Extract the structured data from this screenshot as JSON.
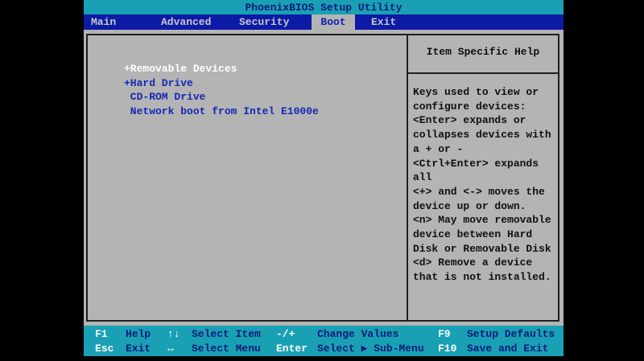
{
  "title": "PhoenixBIOS Setup Utility",
  "tabs": [
    "Main",
    "Advanced",
    "Security",
    "Boot",
    "Exit"
  ],
  "active_tab": "Boot",
  "boot_items": [
    "+Removable Devices",
    "+Hard Drive",
    " CD-ROM Drive",
    " Network boot from Intel E1000e"
  ],
  "help": {
    "title": "Item Specific Help",
    "lines": [
      "Keys used to view or",
      "configure devices:",
      "<Enter> expands or",
      "collapses devices with",
      "a + or -",
      "<Ctrl+Enter> expands",
      "all",
      "<+> and <-> moves the",
      "device up or down.",
      "<n> May move removable",
      "device between Hard",
      "Disk or Removable Disk",
      "<d> Remove a device",
      "that is not installed."
    ]
  },
  "footer": {
    "row1": [
      {
        "key": "F1",
        "label": "Help"
      },
      {
        "key": "↑↓",
        "label": "Select Item"
      },
      {
        "key": "-/+",
        "label": "Change Values"
      },
      {
        "key": "F9",
        "label": "Setup Defaults"
      }
    ],
    "row2": [
      {
        "key": "Esc",
        "label": "Exit"
      },
      {
        "key": "↔",
        "label": "Select Menu"
      },
      {
        "key": "Enter",
        "label": "Select ▶ Sub-Menu"
      },
      {
        "key": "F10",
        "label": "Save and Exit"
      }
    ]
  },
  "colors": {
    "cyan": "#1aa0b4",
    "blue": "#0c1aa6",
    "gray": "#b4b4b4"
  }
}
